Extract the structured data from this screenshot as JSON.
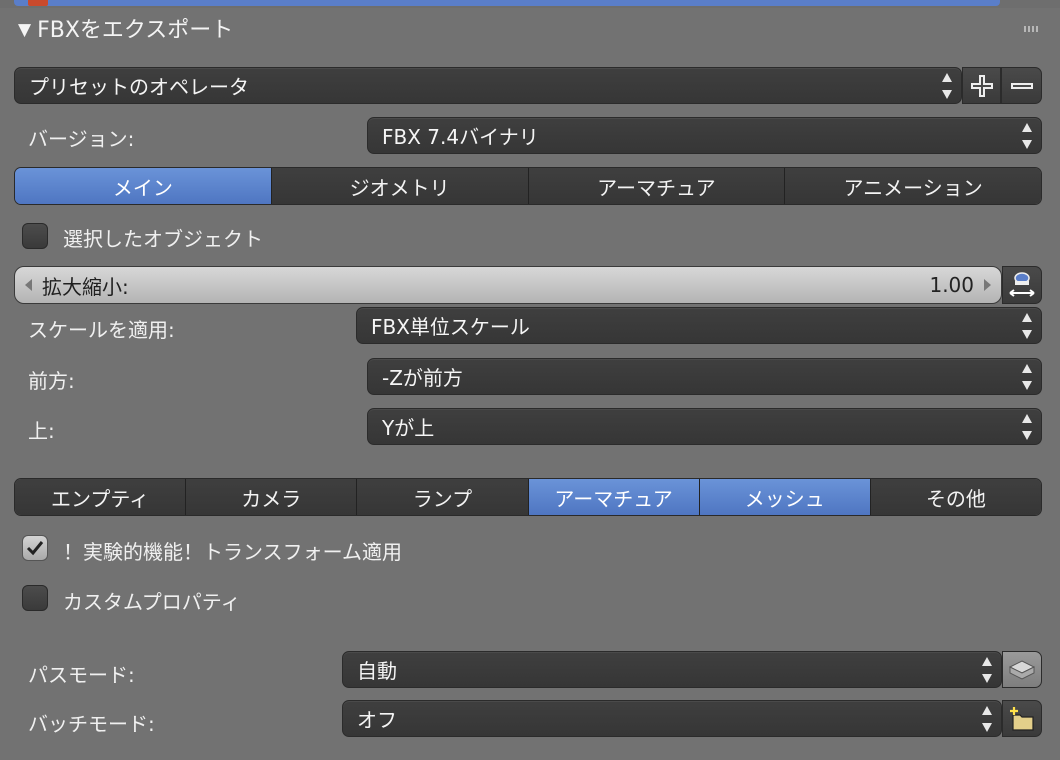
{
  "panel": {
    "title": "FBXをエクスポート"
  },
  "preset": {
    "label": "プリセットのオペレータ"
  },
  "version": {
    "label": "バージョン:",
    "value": "FBX 7.4バイナリ"
  },
  "main_tabs": [
    {
      "label": "メイン",
      "active": true
    },
    {
      "label": "ジオメトリ",
      "active": false
    },
    {
      "label": "アーマチュア",
      "active": false
    },
    {
      "label": "アニメーション",
      "active": false
    }
  ],
  "selected_objects": {
    "label": "選択したオブジェクト",
    "checked": false
  },
  "scale": {
    "label": "拡大縮小:",
    "value": "1.00"
  },
  "apply_scaling": {
    "label": "スケールを適用:",
    "value": "FBX単位スケール"
  },
  "forward": {
    "label": "前方:",
    "value": "-Zが前方"
  },
  "up": {
    "label": "上:",
    "value": "Yが上"
  },
  "object_types": [
    {
      "label": "エンプティ",
      "active": false
    },
    {
      "label": "カメラ",
      "active": false
    },
    {
      "label": "ランプ",
      "active": false
    },
    {
      "label": "アーマチュア",
      "active": true
    },
    {
      "label": "メッシュ",
      "active": true
    },
    {
      "label": "その他",
      "active": false
    }
  ],
  "apply_transform": {
    "label": "！実験的機能！トランスフォーム適用",
    "checked": true
  },
  "custom_props": {
    "label": "カスタムプロパティ",
    "checked": false
  },
  "path_mode": {
    "label": "パスモード:",
    "value": "自動"
  },
  "batch_mode": {
    "label": "バッチモード:",
    "value": "オフ"
  },
  "colors": {
    "active_tab": "#5a82cc",
    "panel_bg": "#727272",
    "control_bg": "#3b3b3b"
  }
}
